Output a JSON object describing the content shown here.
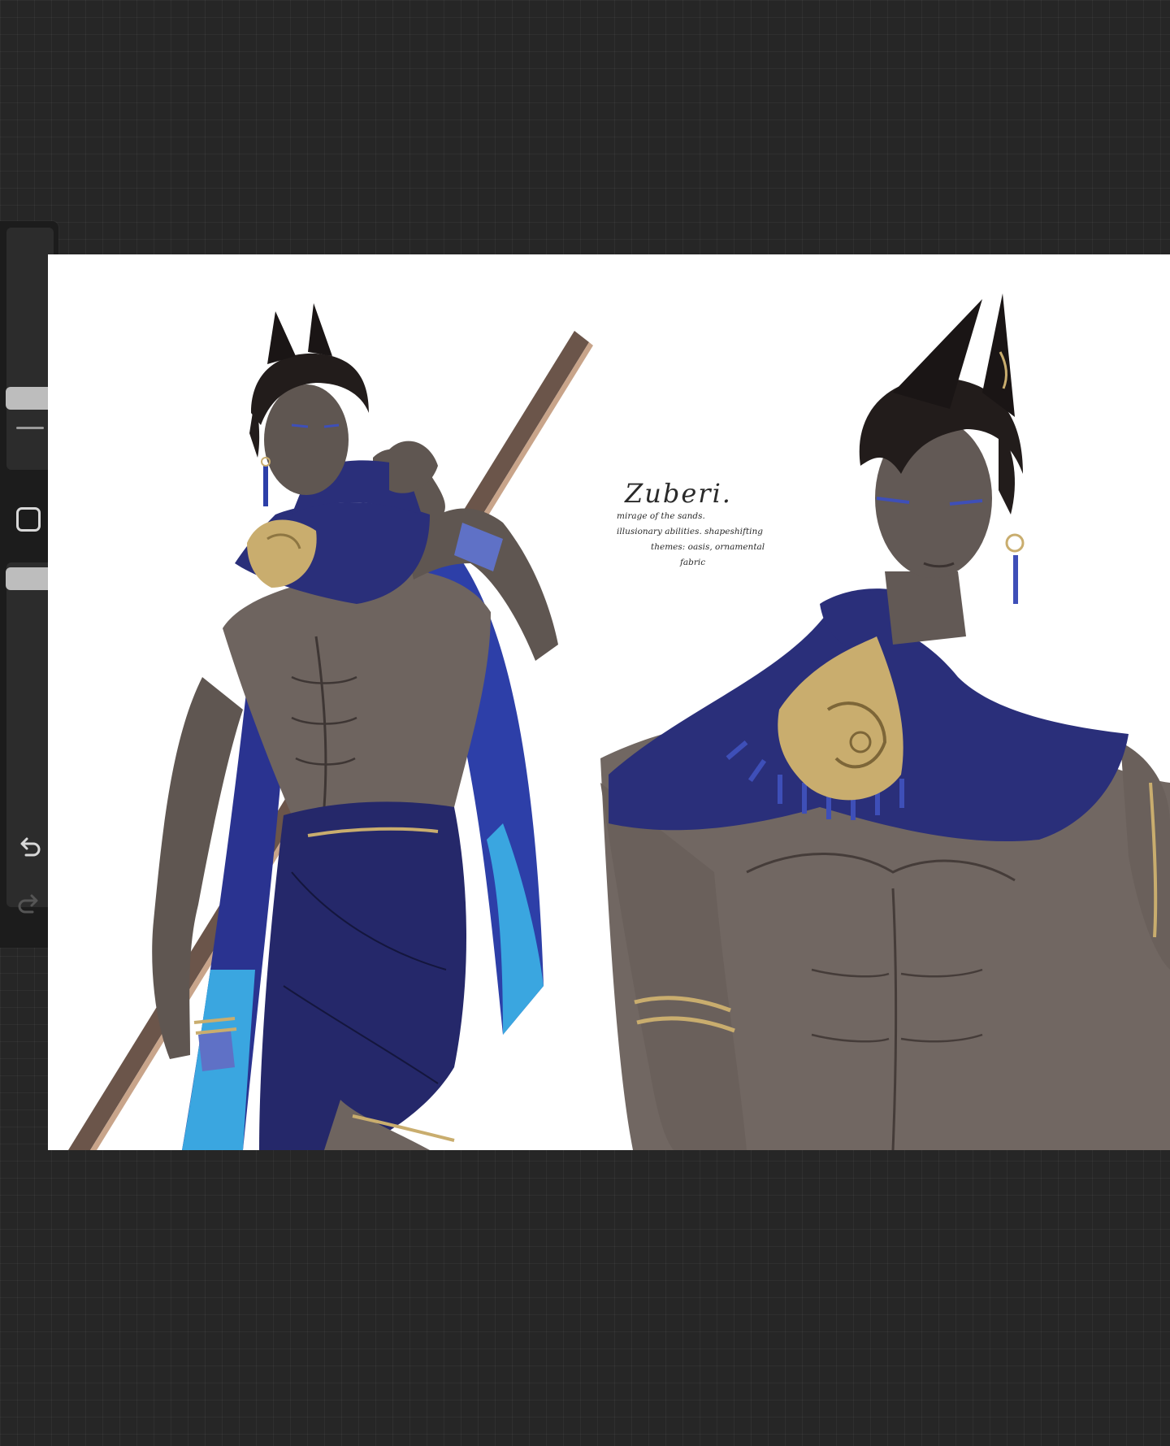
{
  "toolbar": {
    "brush_size_level": 0.25,
    "opacity_level": 0.95,
    "icons": [
      "modify-square-icon",
      "undo-icon",
      "redo-icon"
    ]
  },
  "canvas": {
    "notes": {
      "title": "Zuberi.",
      "line1": "mirage of the sands.",
      "line2": "illusionary abilities. shapeshifting",
      "line3": "themes: oasis, ornamental",
      "line4": "fabric"
    }
  },
  "colors": {
    "background": "#262626",
    "toolbar": "#1c1c1c",
    "scarf": "#2a2f7a",
    "scarf_light": "#3aa6e0",
    "skin": "#6e645f",
    "gold": "#c9ad6e",
    "hair": "#221c1b"
  }
}
